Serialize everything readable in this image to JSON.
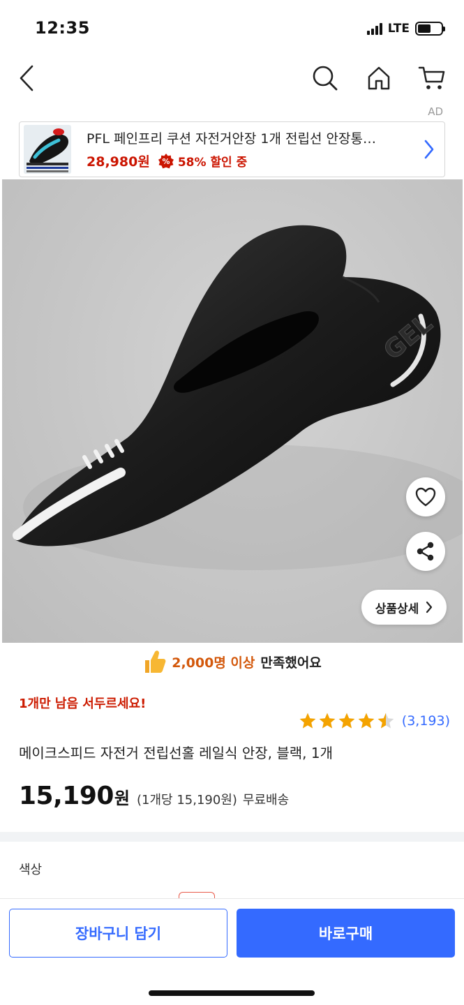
{
  "status_bar": {
    "time": "12:35",
    "network": "LTE",
    "battery_level": 0.55
  },
  "nav": {
    "icons": [
      "back-icon",
      "search-icon",
      "home-icon",
      "cart-icon"
    ]
  },
  "ad": {
    "label": "AD",
    "title": "PFL 페인프리 쿠션 자전거안장 1개 전립선 안장통…",
    "price": "28,980원",
    "discount_text": "58% 할인 중",
    "badge_symbol": "%"
  },
  "product": {
    "detail_button_label": "상품상세",
    "satisfaction_highlight": "2,000명 이상",
    "satisfaction_tail": "만족했어요",
    "urgency": "1개만 남음 서두르세요!",
    "rating_value": 4.5,
    "rating_count": "(3,193)",
    "title": "메이크스피드 자전거 전립선홀 레일식 안장, 블랙, 1개",
    "price": "15,190",
    "price_unit": "원",
    "price_per_unit": "(1개당 15,190원)",
    "shipping": "무료배송"
  },
  "options": {
    "label": "색상"
  },
  "actions": {
    "cart_label": "장바구니 담기",
    "buy_label": "바로구매"
  },
  "colors": {
    "accent_blue": "#346aff",
    "price_red": "#cb1400",
    "star_gold": "#f4a300",
    "highlight_orange": "#d3580b"
  }
}
